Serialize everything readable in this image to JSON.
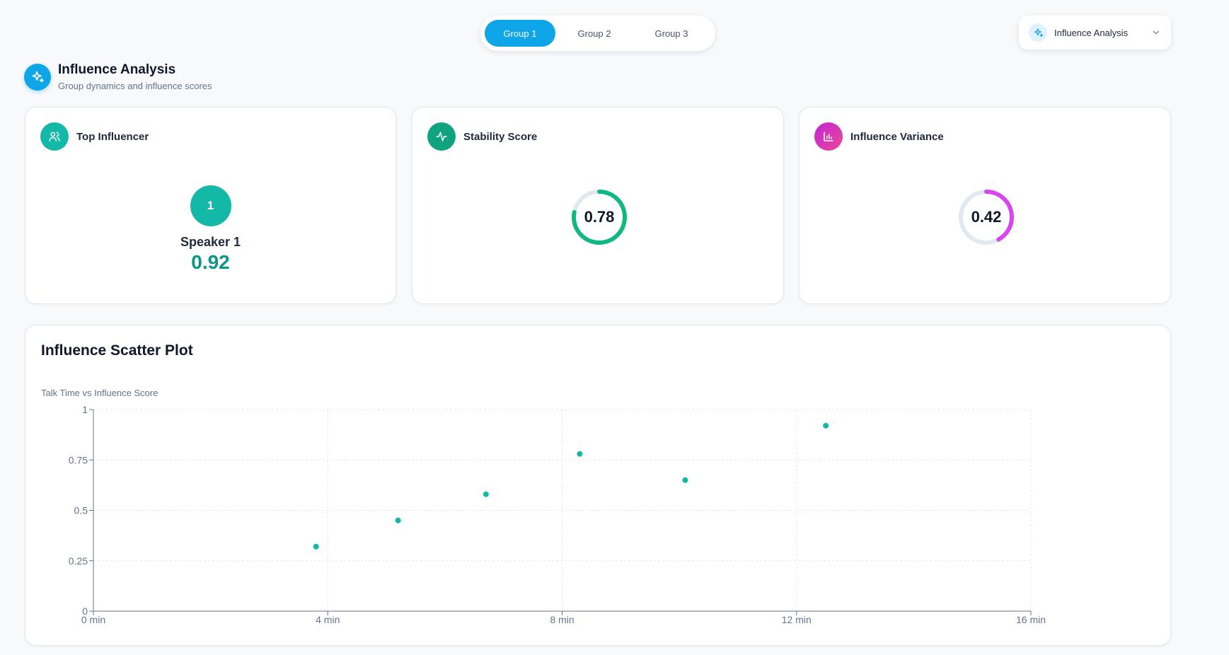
{
  "tabs": [
    {
      "label": "Group 1",
      "active": true
    },
    {
      "label": "Group 2",
      "active": false
    },
    {
      "label": "Group 3",
      "active": false
    }
  ],
  "dropdown": {
    "label": "Influence Analysis",
    "icon": "sparkles-icon"
  },
  "header": {
    "title": "Influence Analysis",
    "subtitle": "Group dynamics and influence scores",
    "icon": "sparkles-icon"
  },
  "cards": {
    "top_influencer": {
      "title": "Top Influencer",
      "icon": "users-icon",
      "rank": "1",
      "speaker": "Speaker 1",
      "score": "0.92"
    },
    "stability": {
      "title": "Stability Score",
      "icon": "activity-icon",
      "value": "0.78",
      "fraction": 0.78,
      "color": "#10b981"
    },
    "variance": {
      "title": "Influence Variance",
      "icon": "bar-chart-icon",
      "value": "0.42",
      "fraction": 0.42,
      "color": "#d946ef"
    }
  },
  "colors": {
    "accent": "#0ea5e9",
    "teal": "#14b8a6",
    "score_text": "#0d9488",
    "ring_track": "#e2e8f0"
  },
  "plot": {
    "title": "Influence Scatter Plot",
    "subtitle": "Talk Time vs Influence Score"
  },
  "chart_data": {
    "type": "scatter",
    "x_ticks": [
      0,
      4,
      8,
      12,
      16
    ],
    "x_tick_labels": [
      "0 min",
      "4 min",
      "8 min",
      "12 min",
      "16 min"
    ],
    "y_ticks": [
      0,
      0.25,
      0.5,
      0.75,
      1
    ],
    "y_tick_labels": [
      "0",
      "0.25",
      "0.5",
      "0.75",
      "1"
    ],
    "xlim": [
      0,
      16
    ],
    "ylim": [
      0,
      1
    ],
    "grid": true,
    "point_color": "#14b8a6",
    "points": [
      {
        "x": 3.8,
        "y": 0.32
      },
      {
        "x": 5.2,
        "y": 0.45
      },
      {
        "x": 6.7,
        "y": 0.58
      },
      {
        "x": 8.3,
        "y": 0.78
      },
      {
        "x": 10.1,
        "y": 0.65
      },
      {
        "x": 12.5,
        "y": 0.92
      }
    ]
  }
}
